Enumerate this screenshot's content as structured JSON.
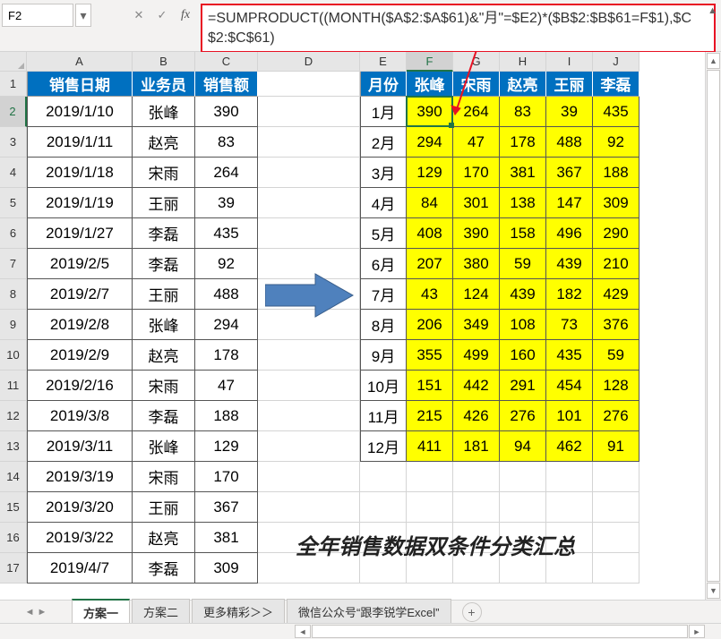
{
  "namebox": {
    "value": "F2"
  },
  "formula": "=SUMPRODUCT((MONTH($A$2:$A$61)&\"月\"=$E2)*($B$2:$B$61=F$1),$C$2:$C$61)",
  "columns": [
    "A",
    "B",
    "C",
    "D",
    "E",
    "F",
    "G",
    "H",
    "I",
    "J"
  ],
  "active_col": "F",
  "active_row": 2,
  "row_numbers": [
    1,
    2,
    3,
    4,
    5,
    6,
    7,
    8,
    9,
    10,
    11,
    12,
    13,
    14,
    15,
    16,
    17
  ],
  "left_table": {
    "headers": [
      "销售日期",
      "业务员",
      "销售额"
    ],
    "rows": [
      [
        "2019/1/10",
        "张峰",
        "390"
      ],
      [
        "2019/1/11",
        "赵亮",
        "83"
      ],
      [
        "2019/1/18",
        "宋雨",
        "264"
      ],
      [
        "2019/1/19",
        "王丽",
        "39"
      ],
      [
        "2019/1/27",
        "李磊",
        "435"
      ],
      [
        "2019/2/5",
        "李磊",
        "92"
      ],
      [
        "2019/2/7",
        "王丽",
        "488"
      ],
      [
        "2019/2/8",
        "张峰",
        "294"
      ],
      [
        "2019/2/9",
        "赵亮",
        "178"
      ],
      [
        "2019/2/16",
        "宋雨",
        "47"
      ],
      [
        "2019/3/8",
        "李磊",
        "188"
      ],
      [
        "2019/3/11",
        "张峰",
        "129"
      ],
      [
        "2019/3/19",
        "宋雨",
        "170"
      ],
      [
        "2019/3/20",
        "王丽",
        "367"
      ],
      [
        "2019/3/22",
        "赵亮",
        "381"
      ],
      [
        "2019/4/7",
        "李磊",
        "309"
      ]
    ]
  },
  "pivot": {
    "month_header": "月份",
    "people": [
      "张峰",
      "宋雨",
      "赵亮",
      "王丽",
      "李磊"
    ],
    "months": [
      "1月",
      "2月",
      "3月",
      "4月",
      "5月",
      "6月",
      "7月",
      "8月",
      "9月",
      "10月",
      "11月",
      "12月"
    ],
    "values": [
      [
        390,
        264,
        83,
        39,
        435
      ],
      [
        294,
        47,
        178,
        488,
        92
      ],
      [
        129,
        170,
        381,
        367,
        188
      ],
      [
        84,
        301,
        138,
        147,
        309
      ],
      [
        408,
        390,
        158,
        496,
        290
      ],
      [
        207,
        380,
        59,
        439,
        210
      ],
      [
        43,
        124,
        439,
        182,
        429
      ],
      [
        206,
        349,
        108,
        73,
        376
      ],
      [
        355,
        499,
        160,
        435,
        59
      ],
      [
        151,
        442,
        291,
        454,
        128
      ],
      [
        215,
        426,
        276,
        101,
        276
      ],
      [
        411,
        181,
        94,
        462,
        91
      ]
    ]
  },
  "caption": "全年销售数据双条件分类汇总",
  "tabs": {
    "items": [
      "方案一",
      "方案二",
      "更多精彩＞＞",
      "微信公众号“跟李锐学Excel”"
    ],
    "active": 0
  },
  "chart_data": {
    "type": "table",
    "title": "全年销售数据双条件分类汇总",
    "row_field": "月份",
    "column_field": "业务员",
    "value_field": "销售额",
    "columns": [
      "张峰",
      "宋雨",
      "赵亮",
      "王丽",
      "李磊"
    ],
    "rows": [
      "1月",
      "2月",
      "3月",
      "4月",
      "5月",
      "6月",
      "7月",
      "8月",
      "9月",
      "10月",
      "11月",
      "12月"
    ],
    "values": [
      [
        390,
        264,
        83,
        39,
        435
      ],
      [
        294,
        47,
        178,
        488,
        92
      ],
      [
        129,
        170,
        381,
        367,
        188
      ],
      [
        84,
        301,
        138,
        147,
        309
      ],
      [
        408,
        390,
        158,
        496,
        290
      ],
      [
        207,
        380,
        59,
        439,
        210
      ],
      [
        43,
        124,
        439,
        182,
        429
      ],
      [
        206,
        349,
        108,
        73,
        376
      ],
      [
        355,
        499,
        160,
        435,
        59
      ],
      [
        151,
        442,
        291,
        454,
        128
      ],
      [
        215,
        426,
        276,
        101,
        276
      ],
      [
        411,
        181,
        94,
        462,
        91
      ]
    ]
  }
}
